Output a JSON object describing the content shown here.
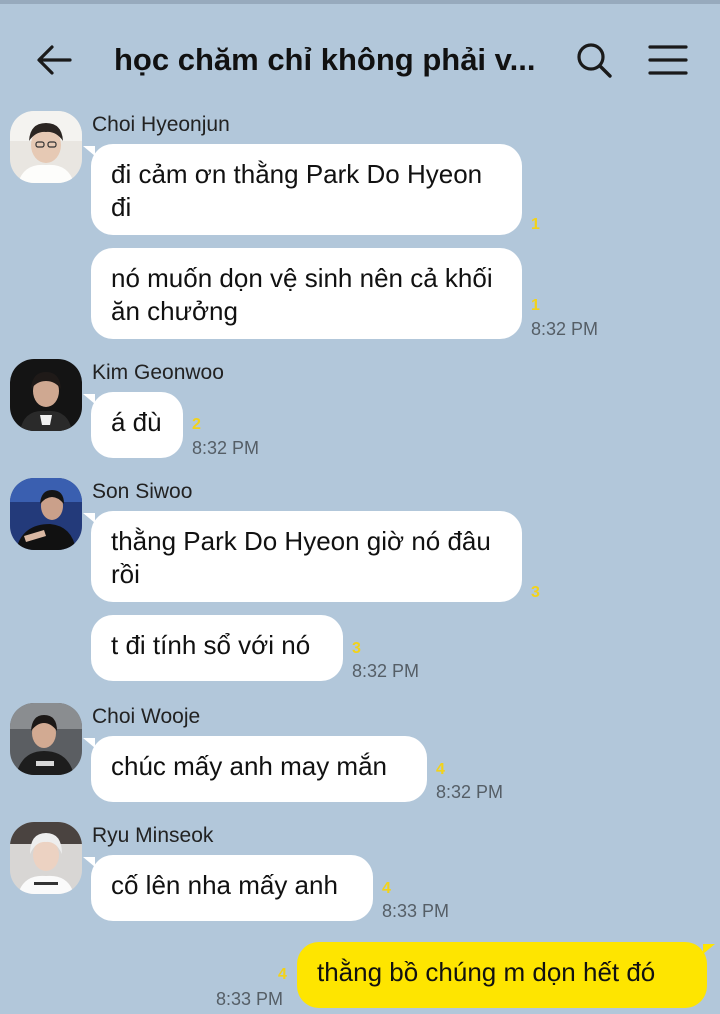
{
  "header": {
    "title": "học chăm chỉ không phải v...",
    "back_icon": "arrow-left-icon",
    "search_icon": "search-icon",
    "menu_icon": "hamburger-menu-icon"
  },
  "colors": {
    "background": "#b2c7da",
    "incoming_bubble": "#ffffff",
    "outgoing_bubble": "#fee500",
    "unread_count": "#f2d21a"
  },
  "messages": [
    {
      "sender": "Choi Hyeonjun",
      "text": "đi cảm ơn thằng Park Do Hyeon đi",
      "unread": "1",
      "time": ""
    },
    {
      "sender": "",
      "text": "nó muốn dọn vệ sinh nên cả khối ăn chưởng",
      "unread": "1",
      "time": "8:32 PM"
    },
    {
      "sender": "Kim Geonwoo",
      "text": "á đù",
      "unread": "2",
      "time": "8:32 PM"
    },
    {
      "sender": "Son Siwoo",
      "text": "thằng Park Do Hyeon giờ nó đâu rồi",
      "unread": "3",
      "time": ""
    },
    {
      "sender": "",
      "text": "t đi tính sổ với nó",
      "unread": "3",
      "time": "8:32 PM"
    },
    {
      "sender": "Choi Wooje",
      "text": "chúc mấy anh may mắn",
      "unread": "4",
      "time": "8:32 PM"
    },
    {
      "sender": "Ryu Minseok",
      "text": "cố lên nha mấy anh",
      "unread": "4",
      "time": "8:33 PM"
    },
    {
      "sender": "me",
      "text": "thằng bồ chúng m dọn hết đó",
      "unread": "4",
      "time": "8:33 PM"
    }
  ]
}
